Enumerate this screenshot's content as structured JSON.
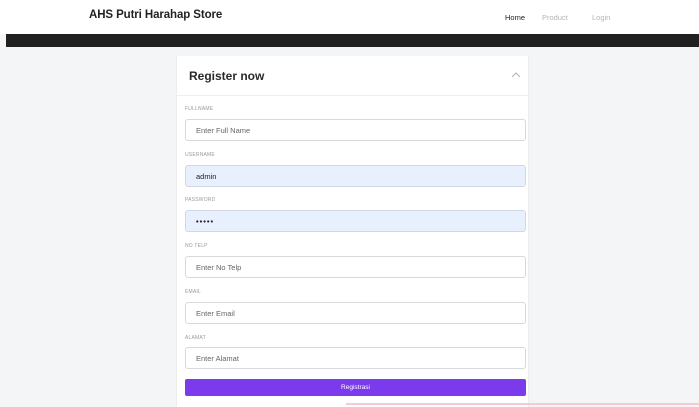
{
  "navbar": {
    "brand": "AHS Putri Harahap Store",
    "links": [
      "Home",
      "Product",
      "Login"
    ]
  },
  "form": {
    "title": "Register now",
    "fields": [
      {
        "label": "FULLNAME",
        "value": "",
        "placeholder": "Enter Full Name"
      },
      {
        "label": "USERNAME",
        "value": "admin",
        "placeholder": ""
      },
      {
        "label": "PASSWORD",
        "value": "•••••",
        "placeholder": ""
      },
      {
        "label": "NO TELP",
        "value": "",
        "placeholder": "Enter No Telp"
      },
      {
        "label": "EMAIL",
        "value": "",
        "placeholder": "Enter Email"
      },
      {
        "label": "ALAMAT",
        "value": "",
        "placeholder": "Enter Alamat"
      }
    ],
    "submit_label": "Registrasi"
  },
  "colors": {
    "accent": "#7c3aed",
    "autofill": "#e8f0fe",
    "band": "#212121"
  },
  "icons": {
    "collapse": "chevron-up-icon"
  }
}
